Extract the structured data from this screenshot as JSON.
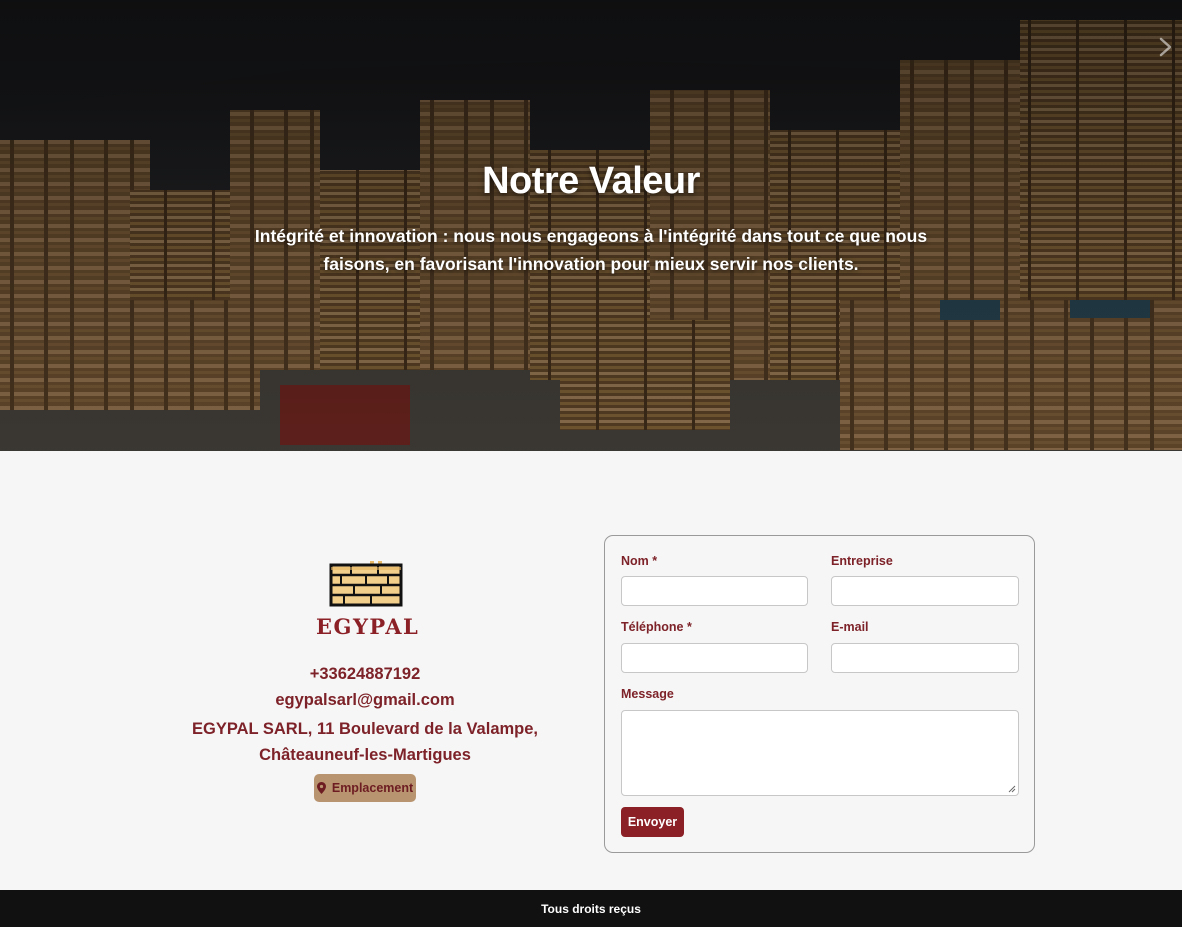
{
  "hero": {
    "title": "Notre Valeur",
    "text": "Intégrité et innovation : nous nous engageons à l'intégrité dans tout ce que nous faisons, en favorisant l'innovation pour mieux servir nos clients."
  },
  "contact": {
    "logo_text": "EGYPAL",
    "phone": "+33624887192",
    "email": "egypalsarl@gmail.com",
    "address": "EGYPAL SARL, 11 Boulevard de la Valampe, Châteauneuf-les-Martigues",
    "location_button": "Emplacement"
  },
  "form": {
    "name_label": "Nom *",
    "company_label": "Entreprise",
    "phone_label": "Téléphone *",
    "email_label": "E-mail",
    "message_label": "Message",
    "name_value": "",
    "company_value": "",
    "phone_value": "",
    "email_value": "",
    "message_value": "",
    "submit_label": "Envoyer"
  },
  "footer": {
    "text": "Tous droits reçus"
  },
  "colors": {
    "brand": "#8b2127",
    "accent_button": "#b89570",
    "footer_bg": "#111111",
    "page_bg": "#f6f6f6"
  },
  "icons": {
    "location": "map-marker-icon",
    "hero_nav": "chevron-right-icon"
  }
}
